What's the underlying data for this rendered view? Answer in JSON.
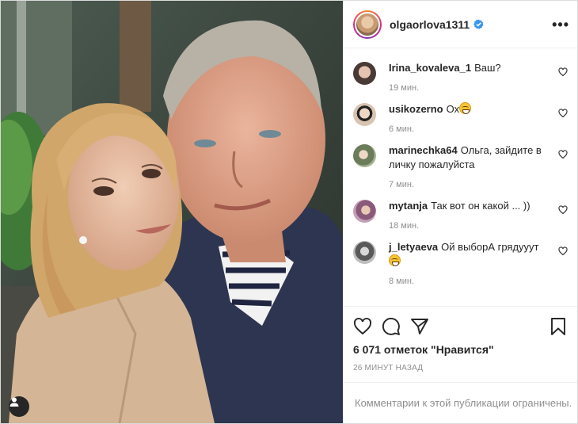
{
  "post": {
    "author": "olgaorlova1311",
    "verified": true,
    "more_icon": "more-horizontal-icon"
  },
  "comments": [
    {
      "user": "Irina_kovaleva_1",
      "text": "Ваш?",
      "time": "19 мин.",
      "avatar_color": "#7a6a60"
    },
    {
      "user": "usikozerno",
      "text": "Ох",
      "emoji": "grinning-sweat",
      "time": "6 мин.",
      "avatar_color": "#c9b4a4"
    },
    {
      "user": "marinechka64",
      "text": "Ольга, зайдите в личку пожалуйста",
      "time": "7 мин.",
      "avatar_color": "#6b7c5a"
    },
    {
      "user": "mytanja",
      "text": "Так вот он какой ... ))",
      "time": "18 мин.",
      "avatar_color": "#8a5a7a"
    },
    {
      "user": "j_letyaeva",
      "text": "Ой выборА грядууут",
      "emoji": "grinning-sweat",
      "time": "8 мин.",
      "avatar_color": "#9a9a9a"
    }
  ],
  "actions": {
    "like_icon": "heart-icon",
    "comment_icon": "comment-icon",
    "share_icon": "share-icon",
    "save_icon": "bookmark-icon"
  },
  "likes": "6 071 отметок \"Нравится\"",
  "posted": "26 минут назад",
  "comments_restricted": "Комментарии к этой публикации ограничены.",
  "colors": {
    "verified_blue": "#3897f0",
    "meta_gray": "#8e8e8e",
    "text": "#262626"
  }
}
